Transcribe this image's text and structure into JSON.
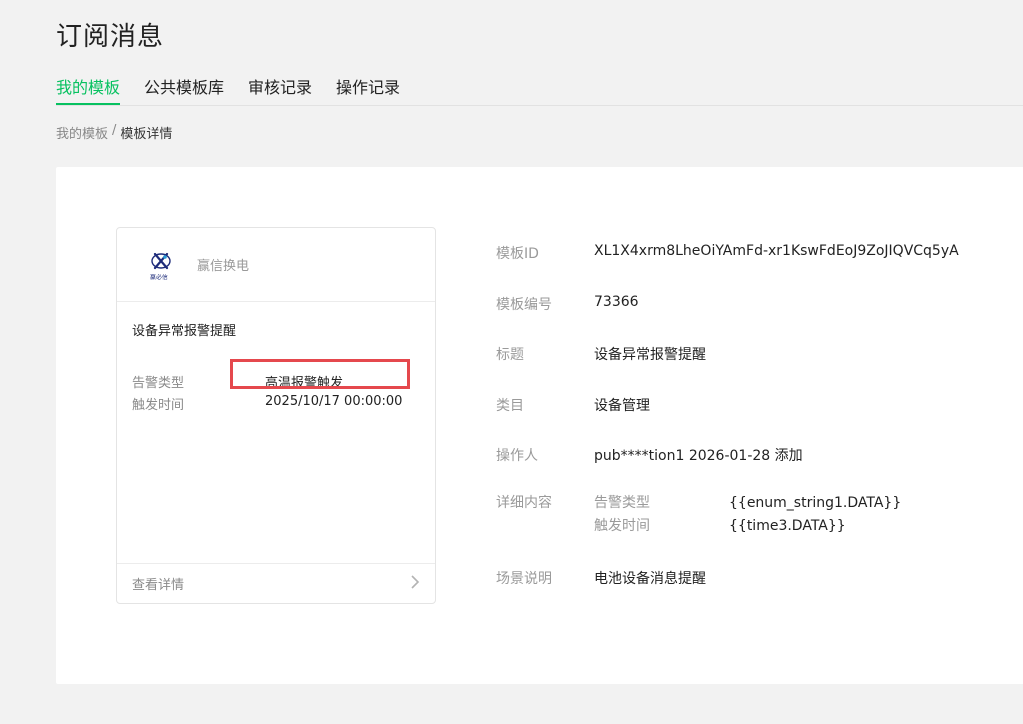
{
  "page": {
    "title": "订阅消息"
  },
  "tabs": [
    {
      "label": "我的模板",
      "active": true
    },
    {
      "label": "公共模板库",
      "active": false
    },
    {
      "label": "审核记录",
      "active": false
    },
    {
      "label": "操作记录",
      "active": false
    }
  ],
  "breadcrumb": {
    "parent": "我的模板",
    "separator": "/",
    "current": "模板详情"
  },
  "preview": {
    "logo_icon": "company-logo-icon",
    "logo_text": "赢必信",
    "brand": "赢信换电",
    "title": "设备异常报警提醒",
    "fields": [
      {
        "key": "告警类型",
        "value": "高温报警触发"
      },
      {
        "key": "触发时间",
        "value": "2025/10/17 00:00:00"
      }
    ],
    "footer_label": "查看详情",
    "footer_icon": "chevron-right-icon",
    "highlight_color": "#e5484d"
  },
  "details": {
    "template_id": {
      "label": "模板ID",
      "value": "XL1X4xrm8LheOiYAmFd-xr1KswFdEoJ9ZoJIQVCq5yA"
    },
    "template_no": {
      "label": "模板编号",
      "value": "73366"
    },
    "title": {
      "label": "标题",
      "value": "设备异常报警提醒"
    },
    "category": {
      "label": "类目",
      "value": "设备管理"
    },
    "operator": {
      "label": "操作人",
      "value": "pub****tion1 2026-01-28 添加"
    },
    "content": {
      "label": "详细内容",
      "rows": [
        {
          "key": "告警类型",
          "value": "{{enum_string1.DATA}}"
        },
        {
          "key": "触发时间",
          "value": "{{time3.DATA}}"
        }
      ]
    },
    "scene": {
      "label": "场景说明",
      "value": "电池设备消息提醒"
    }
  },
  "colors": {
    "accent": "#07c160",
    "background": "#f2f2f2"
  }
}
